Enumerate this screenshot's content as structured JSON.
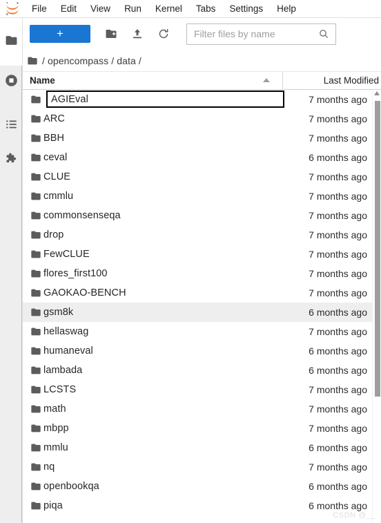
{
  "menubar": {
    "logo": "jupyter-logo",
    "items": [
      {
        "label": "File"
      },
      {
        "label": "Edit"
      },
      {
        "label": "View"
      },
      {
        "label": "Run"
      },
      {
        "label": "Kernel"
      },
      {
        "label": "Tabs"
      },
      {
        "label": "Settings"
      },
      {
        "label": "Help"
      }
    ]
  },
  "activitybar": {
    "items": [
      {
        "name": "file-browser",
        "icon": "folder-icon",
        "selected": true
      },
      {
        "name": "running-terminals-and-kernels",
        "icon": "stop-circle-icon",
        "selected": false
      },
      {
        "name": "commands",
        "icon": "list-icon",
        "selected": false
      },
      {
        "name": "extension-manager",
        "icon": "puzzle-piece-icon",
        "selected": false
      }
    ]
  },
  "toolbar": {
    "new_launcher_label": "+",
    "new_folder_icon": "new-folder-icon",
    "upload_icon": "upload-icon",
    "refresh_icon": "refresh-icon"
  },
  "filter": {
    "value": "",
    "placeholder": "Filter files by name",
    "icon": "search-icon"
  },
  "breadcrumb": {
    "icon": "folder-icon",
    "path": "/ opencompass / data /"
  },
  "columns": {
    "name": "Name",
    "last_modified": "Last Modified",
    "sort_direction": "ascending"
  },
  "files": [
    {
      "name": "AGIEval",
      "modified": "7 months ago",
      "editing": true,
      "selected": false
    },
    {
      "name": "ARC",
      "modified": "7 months ago",
      "editing": false,
      "selected": false
    },
    {
      "name": "BBH",
      "modified": "7 months ago",
      "editing": false,
      "selected": false
    },
    {
      "name": "ceval",
      "modified": "6 months ago",
      "editing": false,
      "selected": false
    },
    {
      "name": "CLUE",
      "modified": "7 months ago",
      "editing": false,
      "selected": false
    },
    {
      "name": "cmmlu",
      "modified": "7 months ago",
      "editing": false,
      "selected": false
    },
    {
      "name": "commonsenseqa",
      "modified": "7 months ago",
      "editing": false,
      "selected": false
    },
    {
      "name": "drop",
      "modified": "7 months ago",
      "editing": false,
      "selected": false
    },
    {
      "name": "FewCLUE",
      "modified": "7 months ago",
      "editing": false,
      "selected": false
    },
    {
      "name": "flores_first100",
      "modified": "7 months ago",
      "editing": false,
      "selected": false
    },
    {
      "name": "GAOKAO-BENCH",
      "modified": "7 months ago",
      "editing": false,
      "selected": false
    },
    {
      "name": "gsm8k",
      "modified": "6 months ago",
      "editing": false,
      "selected": true
    },
    {
      "name": "hellaswag",
      "modified": "7 months ago",
      "editing": false,
      "selected": false
    },
    {
      "name": "humaneval",
      "modified": "6 months ago",
      "editing": false,
      "selected": false
    },
    {
      "name": "lambada",
      "modified": "6 months ago",
      "editing": false,
      "selected": false
    },
    {
      "name": "LCSTS",
      "modified": "7 months ago",
      "editing": false,
      "selected": false
    },
    {
      "name": "math",
      "modified": "7 months ago",
      "editing": false,
      "selected": false
    },
    {
      "name": "mbpp",
      "modified": "7 months ago",
      "editing": false,
      "selected": false
    },
    {
      "name": "mmlu",
      "modified": "6 months ago",
      "editing": false,
      "selected": false
    },
    {
      "name": "nq",
      "modified": "7 months ago",
      "editing": false,
      "selected": false
    },
    {
      "name": "openbookqa",
      "modified": "6 months ago",
      "editing": false,
      "selected": false
    },
    {
      "name": "piqa",
      "modified": "6 months ago",
      "editing": false,
      "selected": false
    }
  ],
  "watermark": "CSDN @__",
  "colors": {
    "accent": "#1976d2",
    "selected_row": "#eeeeee",
    "icon": "#616161",
    "text": "#262626"
  }
}
